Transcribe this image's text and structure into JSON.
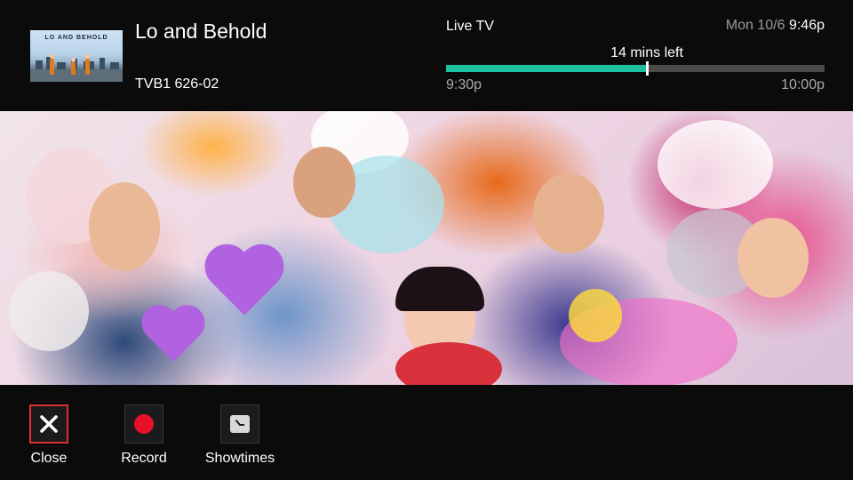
{
  "program": {
    "thumbnail_title": "LO AND BEHOLD",
    "title": "Lo and Behold",
    "channel": "TVB1 626-02"
  },
  "status": {
    "live_label": "Live TV",
    "date": "Mon 10/6",
    "time": "9:46p",
    "time_left": "14 mins left",
    "start_time": "9:30p",
    "end_time": "10:00p",
    "progress_fraction": 0.53,
    "progress_color": "#1fc0a0"
  },
  "actions": [
    {
      "label": "Close",
      "icon": "close-icon",
      "selected": true
    },
    {
      "label": "Record",
      "icon": "record-icon",
      "selected": false
    },
    {
      "label": "Showtimes",
      "icon": "showtimes-icon",
      "selected": false
    }
  ],
  "colors": {
    "selection_border": "#d93131",
    "record": "#e8102c",
    "background": "#0b0b0b"
  }
}
